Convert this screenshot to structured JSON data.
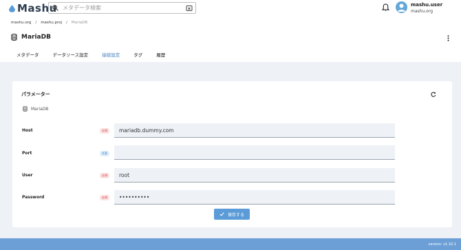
{
  "header": {
    "logo_text": "Mashu",
    "search_placeholder": "メタデータ検索",
    "user_name": "mashu.user",
    "user_org": "mashu.org"
  },
  "breadcrumb": {
    "items": [
      "mashu.org",
      "mashu.proj",
      "MariaDB"
    ],
    "separator": "/"
  },
  "page": {
    "title": "MariaDB"
  },
  "tabs": [
    {
      "label": "メタデータ",
      "active": false
    },
    {
      "label": "データソース設定",
      "active": false
    },
    {
      "label": "接続設定",
      "active": true
    },
    {
      "label": "タグ",
      "active": false
    },
    {
      "label": "履歴",
      "active": false
    }
  ],
  "card": {
    "title": "パラメーター",
    "subtitle": "MariaDB",
    "fields": [
      {
        "label": "Host",
        "badge": "必須",
        "badge_type": "required",
        "value": "mariadb.dummy.com"
      },
      {
        "label": "Port",
        "badge": "任意",
        "badge_type": "optional",
        "value": ""
      },
      {
        "label": "User",
        "badge": "必須",
        "badge_type": "required",
        "value": "root"
      },
      {
        "label": "Password",
        "badge": "必須",
        "badge_type": "required",
        "value": "••••••••••"
      }
    ],
    "save_label": "保存する"
  },
  "footer": {
    "version": "version: v1.10.1"
  },
  "colors": {
    "accent": "#5a9bd8",
    "footer": "#6c9fd6",
    "active_tab": "#3f7fbf",
    "page_bg": "#eef1f6"
  }
}
